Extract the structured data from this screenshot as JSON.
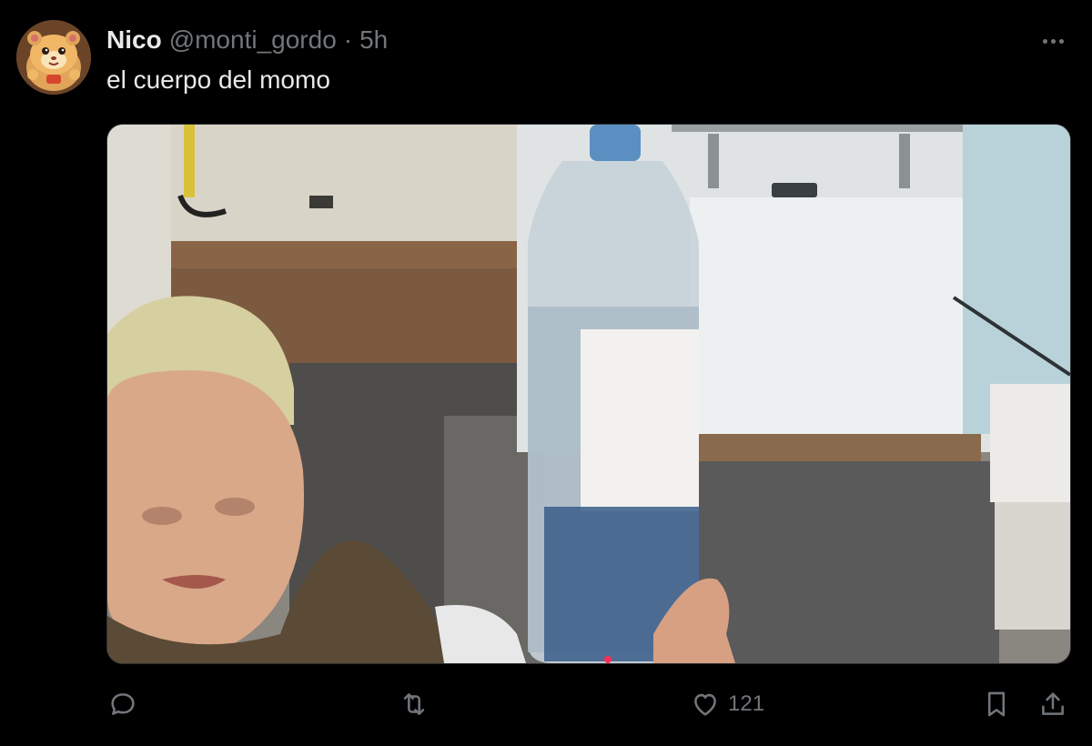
{
  "tweet": {
    "author_name": "Nico",
    "author_handle": "@monti_gordo",
    "separator": "·",
    "timestamp": "5h",
    "text": "el cuerpo del momo",
    "likes_count": "121"
  },
  "icons": {
    "more": "more-horizontal-icon",
    "reply": "reply-bubble-icon",
    "retweet": "retweet-icon",
    "like": "heart-icon",
    "bookmark": "bookmark-icon",
    "share": "share-upload-icon"
  },
  "colors": {
    "background": "#000000",
    "primary_text": "#e7e9ea",
    "secondary_text": "#71767b",
    "border": "#2f3336"
  }
}
